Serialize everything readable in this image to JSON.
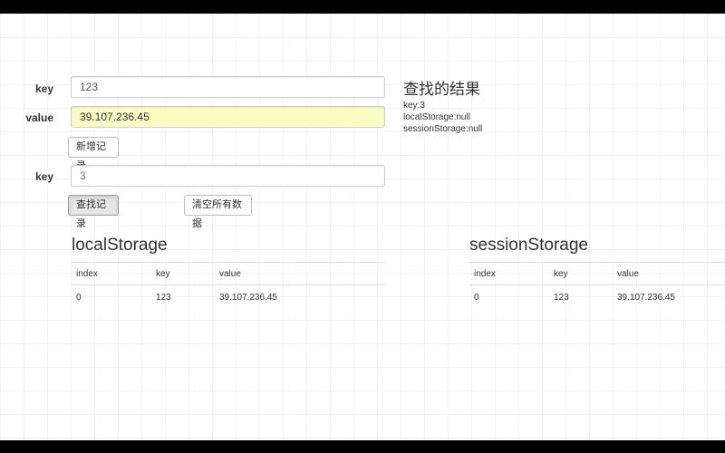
{
  "form": {
    "key_label": "key",
    "key_value": "123",
    "value_label": "value",
    "value_value": "39.107.236.45",
    "add_button": "新增记录",
    "search_key_label": "key",
    "search_key_value": "3",
    "search_button": "查找记录",
    "clear_button": "清空所有数据"
  },
  "result": {
    "title": "查找的结果",
    "lines": [
      "key:3",
      "localStorage:null",
      "sessionStorage:null"
    ]
  },
  "local_storage": {
    "title": "localStorage",
    "columns": [
      "index",
      "key",
      "value"
    ],
    "rows": [
      [
        "0",
        "123",
        "39.107.236.45"
      ]
    ]
  },
  "session_storage": {
    "title": "sessionStorage",
    "columns": [
      "index",
      "key",
      "value"
    ],
    "rows": [
      [
        "0",
        "123",
        "39.107.236.45"
      ]
    ]
  },
  "colors": {
    "autofill_background": "#fafdc2",
    "page_background": "#ffffff",
    "letterbox": "#000000"
  }
}
